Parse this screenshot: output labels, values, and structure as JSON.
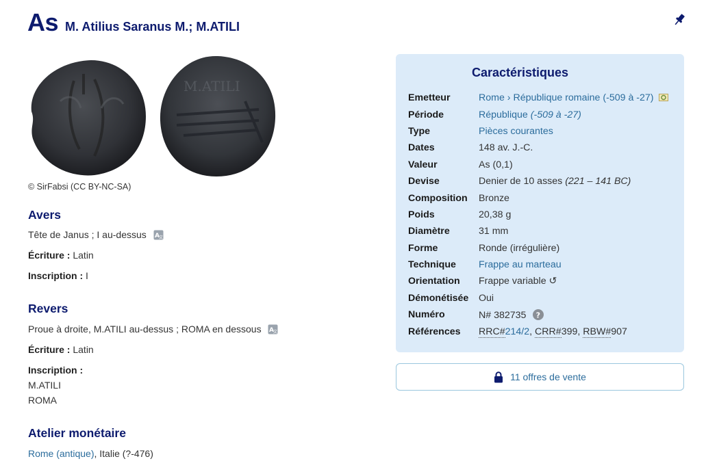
{
  "title": {
    "main": "As",
    "sub": "M. Atilius Saranus M.; M.ATILI"
  },
  "image_credit": "© SirFabsi (CC BY-NC-SA)",
  "obverse": {
    "heading": "Avers",
    "description": "Tête de Janus ; I au-dessus",
    "script_label": "Écriture :",
    "script_value": "Latin",
    "inscription_label": "Inscription :",
    "inscription_value": "I"
  },
  "reverse": {
    "heading": "Revers",
    "description": "Proue à droite, M.ATILI au-dessus ; ROMA en dessous",
    "script_label": "Écriture :",
    "script_value": "Latin",
    "inscription_label": "Inscription :",
    "inscription_lines": [
      "M.ATILI",
      "ROMA"
    ]
  },
  "mint": {
    "heading": "Atelier monétaire",
    "link": "Rome (antique)",
    "rest": ", Italie (?-476)"
  },
  "characteristics": {
    "title": "Caractéristiques",
    "emitter": {
      "label": "Emetteur",
      "rome": "Rome",
      "sep": " › ",
      "republic": "République romaine (-509 à -27)"
    },
    "period": {
      "label": "Période",
      "link": "République",
      "italic": "(-509 à -27)"
    },
    "type": {
      "label": "Type",
      "value": "Pièces courantes"
    },
    "dates": {
      "label": "Dates",
      "value": "148 av. J.-C."
    },
    "value": {
      "label": "Valeur",
      "value": "As (0,1)"
    },
    "currency": {
      "label": "Devise",
      "value": "Denier de 10 asses ",
      "italic": "(221 – 141 BC)"
    },
    "composition": {
      "label": "Composition",
      "value": "Bronze"
    },
    "weight": {
      "label": "Poids",
      "value": "20,38 g"
    },
    "diameter": {
      "label": "Diamètre",
      "value": "31 mm"
    },
    "shape": {
      "label": "Forme",
      "value": "Ronde (irrégulière)"
    },
    "technique": {
      "label": "Technique",
      "value": "Frappe au marteau"
    },
    "orientation": {
      "label": "Orientation",
      "value": "Frappe variable ↺"
    },
    "demonetized": {
      "label": "Démonétisée",
      "value": "Oui"
    },
    "number": {
      "label": "Numéro",
      "value": "N# 382735"
    },
    "references": {
      "label": "Références",
      "rrc_key": "RRC#",
      "rrc_value": "214/2",
      "crr_key": "CRR#",
      "crr_value": "399",
      "rbw_key": "RBW#",
      "rbw_value": "907"
    }
  },
  "offers_button": "11 offres de vente",
  "colors": {
    "navy": "#0d1b6e",
    "link": "#2b6c9c",
    "panel": "#dcebf9"
  },
  "icons": [
    "pin-icon",
    "translate-icon",
    "flag-icon",
    "help-icon",
    "lock-icon"
  ]
}
